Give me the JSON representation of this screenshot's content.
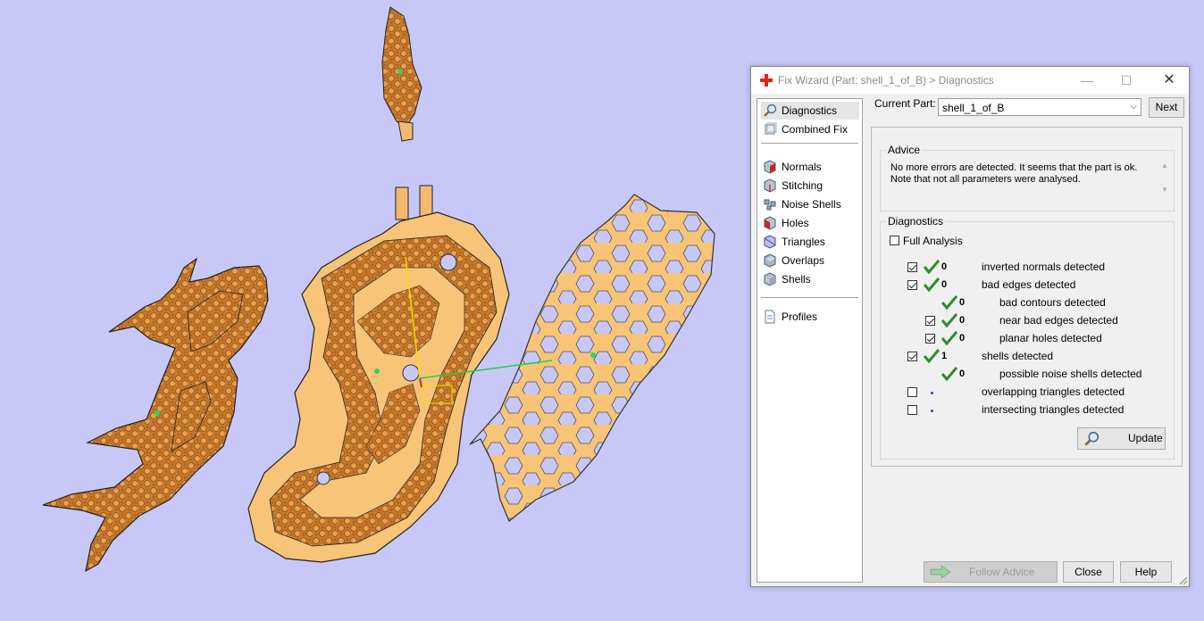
{
  "window": {
    "title": "Fix Wizard (Part: shell_1_of_B) > Diagnostics",
    "close_glyph": "✕",
    "min_glyph": "—",
    "max_glyph": "☐"
  },
  "nav": {
    "items": [
      {
        "label": "Diagnostics",
        "icon": "magnifier-icon",
        "selected": true
      },
      {
        "label": "Combined Fix",
        "icon": "combined-fix-icon"
      },
      {
        "label": "Normals",
        "icon": "normals-cube-icon"
      },
      {
        "label": "Stitching",
        "icon": "stitching-cube-icon"
      },
      {
        "label": "Noise Shells",
        "icon": "noise-shells-icon"
      },
      {
        "label": "Holes",
        "icon": "holes-cube-icon"
      },
      {
        "label": "Triangles",
        "icon": "triangles-cube-icon"
      },
      {
        "label": "Overlaps",
        "icon": "overlaps-cube-icon"
      },
      {
        "label": "Shells",
        "icon": "shells-cube-icon"
      },
      {
        "label": "Profiles",
        "icon": "document-icon"
      }
    ]
  },
  "current_part": {
    "label": "Current Part:",
    "value": "shell_1_of_B",
    "next_label": "Next"
  },
  "advice": {
    "title": "Advice",
    "text": "No more errors are detected. It seems that the part is ok. Note that not all parameters were analysed."
  },
  "diagnostics": {
    "title": "Diagnostics",
    "full_analysis_label": "Full Analysis",
    "full_analysis_checked": false,
    "rows": [
      {
        "checked": true,
        "status": "ok",
        "count": "0",
        "label": "inverted normals detected"
      },
      {
        "checked": true,
        "status": "ok",
        "count": "0",
        "label": "bad edges detected"
      },
      {
        "status": "ok",
        "count": "0",
        "label": "bad contours detected"
      },
      {
        "checked": true,
        "status": "ok",
        "count": "0",
        "label": "near bad edges detected"
      },
      {
        "checked": true,
        "status": "ok",
        "count": "0",
        "label": "planar holes detected"
      },
      {
        "checked": true,
        "status": "ok",
        "count": "1",
        "label": "shells detected"
      },
      {
        "status": "ok",
        "count": "0",
        "label": "possible noise shells detected"
      },
      {
        "checked": false,
        "status": "unknown",
        "count": "",
        "label": "overlapping triangles detected"
      },
      {
        "checked": false,
        "status": "unknown",
        "count": "",
        "label": "intersecting triangles detected"
      }
    ],
    "update_label": "Update"
  },
  "footer": {
    "follow_advice_label": "Follow Advice",
    "close_label": "Close",
    "help_label": "Help"
  },
  "colors": {
    "viewport_bg": "#c8c8f8",
    "part_fill": "#f8c477",
    "part_dark": "#c7782a",
    "check_green": "#2e8b2e",
    "title_cross_red": "#d9261c"
  }
}
